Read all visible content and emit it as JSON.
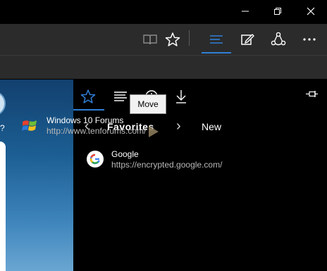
{
  "titlebar": {
    "minimize_icon": "minimize-icon",
    "restore_icon": "restore-icon",
    "close_icon": "close-icon"
  },
  "toolbar": {
    "icons": [
      "reading-view-icon",
      "add-favorite-star-icon",
      "hub-icon",
      "web-note-icon",
      "share-icon",
      "more-icon"
    ],
    "accent": "#2f7fd6"
  },
  "hub": {
    "tabs": [
      "favorites-star-icon",
      "reading-list-icon",
      "history-icon",
      "downloads-icon"
    ],
    "pin_icon": "pin-icon",
    "back_arrow": "‹",
    "forward_arrow": "›",
    "section_title": "Favorites",
    "new_label": "New",
    "items": [
      {
        "title": "Windows 10 Forums",
        "url": "http://www.tenforums.com/"
      },
      {
        "title": "Google",
        "url": "https://encrypted.google.com/"
      }
    ]
  },
  "tooltip": {
    "text": "Move"
  },
  "page": {
    "fragment_text": "?"
  }
}
